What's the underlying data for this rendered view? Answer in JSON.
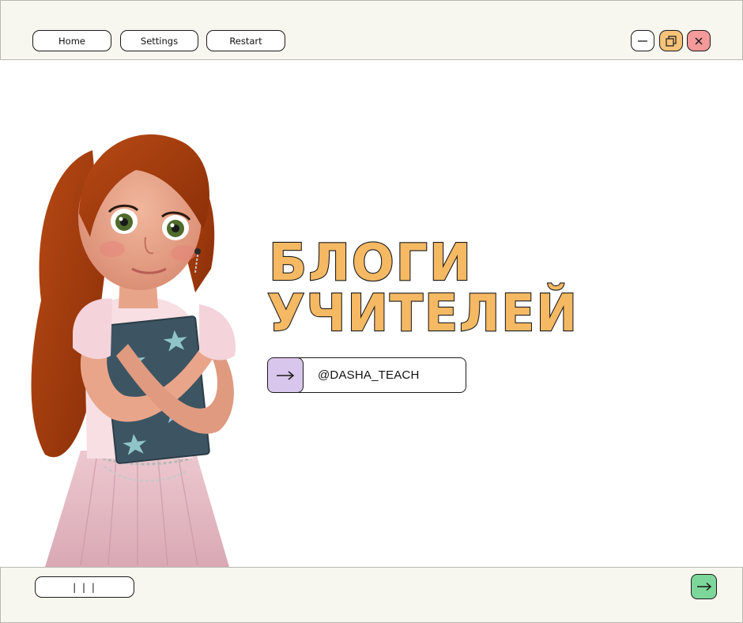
{
  "topbar": {
    "nav": [
      {
        "label": "Home"
      },
      {
        "label": "Settings"
      },
      {
        "label": "Restart"
      }
    ],
    "window_controls": {
      "minimize_color": "#ffffff",
      "maximize_color": "#f6c37a",
      "close_color": "#f59a9a"
    }
  },
  "hero": {
    "title_line1": "БЛОГИ",
    "title_line2": "УЧИТЕЛЕЙ",
    "title_color": "#f5b964",
    "handle": "@DASHA_TEACH",
    "handle_arrow_color": "#d9c6ec"
  },
  "bottombar": {
    "menu_label": "| | |",
    "next_color": "#7dd69a"
  }
}
